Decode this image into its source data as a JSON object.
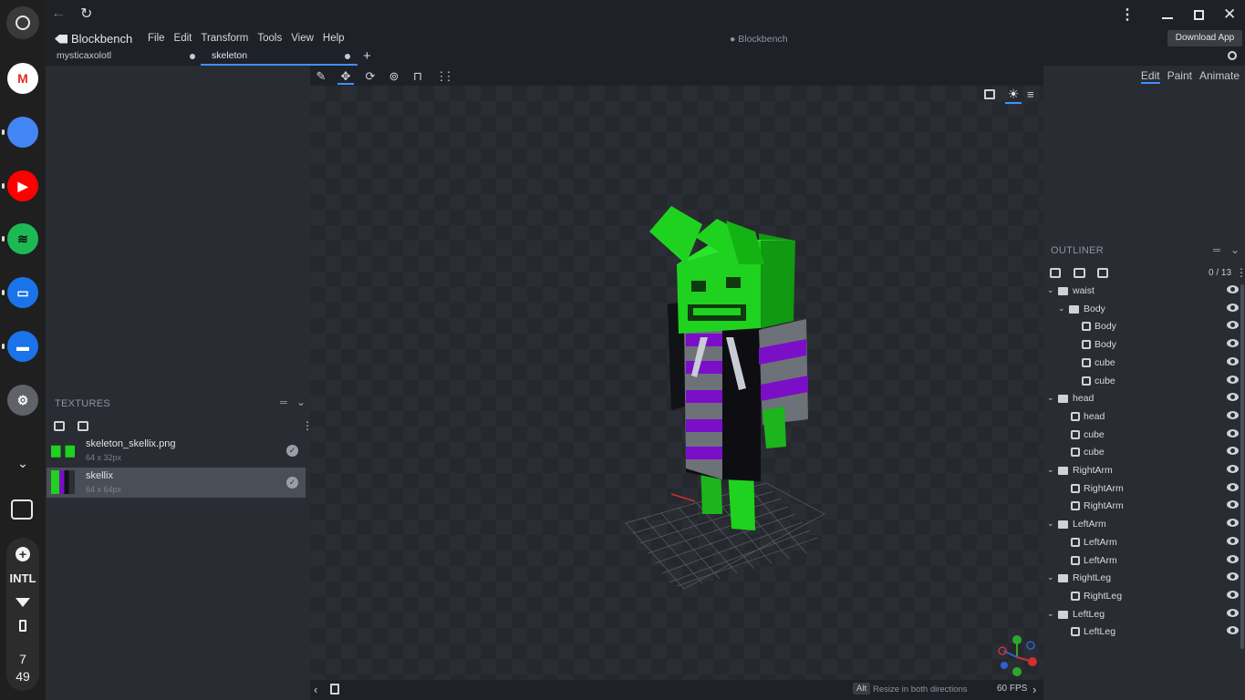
{
  "shelf": {
    "apps": [
      {
        "name": "gmail-app-icon",
        "glyph": "M",
        "color": "#ffffff",
        "fg": "#d93025"
      },
      {
        "name": "chrome-app-icon",
        "glyph": "",
        "color": "#4285f4",
        "fg": "#ffffff"
      },
      {
        "name": "youtube-app-icon",
        "glyph": "▶",
        "color": "#ff0000",
        "fg": "#ffffff"
      },
      {
        "name": "spotify-app-icon",
        "glyph": "≋",
        "color": "#1db954",
        "fg": "#111111"
      },
      {
        "name": "remote-desktop-app-icon",
        "glyph": "▭",
        "color": "#1a73e8",
        "fg": "#ffffff"
      },
      {
        "name": "files-app-icon",
        "glyph": "▬",
        "color": "#1a73e8",
        "fg": "#ffffff"
      },
      {
        "name": "settings-app-icon",
        "glyph": "⚙",
        "color": "#5f6368",
        "fg": "#ffffff"
      }
    ],
    "ime": "INTL",
    "clock_hour": "7",
    "clock_min": "49"
  },
  "app": {
    "title": "Blockbench",
    "center_title": "● Blockbench",
    "menu": [
      "File",
      "Edit",
      "Transform",
      "Tools",
      "View",
      "Help"
    ],
    "tooltip": "Download App"
  },
  "tabs": [
    {
      "label": "mysticaxolotl",
      "active": false
    },
    {
      "label": "skeleton",
      "active": true
    }
  ],
  "textures": {
    "header": "TEXTURES",
    "items": [
      {
        "name": "skeleton_skellix.png",
        "size": "64 x 32px",
        "selected": false
      },
      {
        "name": "skellix",
        "size": "64 x 64px",
        "selected": true
      }
    ]
  },
  "modes": [
    "Edit",
    "Paint",
    "Animate"
  ],
  "outliner": {
    "header": "OUTLINER",
    "count": "0 / 13",
    "nodes": [
      {
        "label": "waist",
        "kind": "group",
        "depth": 0
      },
      {
        "label": "Body",
        "kind": "group",
        "depth": 1
      },
      {
        "label": "Body",
        "kind": "cube",
        "depth": 2
      },
      {
        "label": "Body",
        "kind": "cube",
        "depth": 2
      },
      {
        "label": "cube",
        "kind": "cube",
        "depth": 2
      },
      {
        "label": "cube",
        "kind": "cube",
        "depth": 2
      },
      {
        "label": "head",
        "kind": "group",
        "depth": 0
      },
      {
        "label": "head",
        "kind": "cube",
        "depth": 1
      },
      {
        "label": "cube",
        "kind": "cube",
        "depth": 1
      },
      {
        "label": "cube",
        "kind": "cube",
        "depth": 1
      },
      {
        "label": "RightArm",
        "kind": "group",
        "depth": 0
      },
      {
        "label": "RightArm",
        "kind": "cube",
        "depth": 1
      },
      {
        "label": "RightArm",
        "kind": "cube",
        "depth": 1
      },
      {
        "label": "LeftArm",
        "kind": "group",
        "depth": 0
      },
      {
        "label": "LeftArm",
        "kind": "cube",
        "depth": 1
      },
      {
        "label": "LeftArm",
        "kind": "cube",
        "depth": 1
      },
      {
        "label": "RightLeg",
        "kind": "group",
        "depth": 0
      },
      {
        "label": "RightLeg",
        "kind": "cube",
        "depth": 1
      },
      {
        "label": "LeftLeg",
        "kind": "group",
        "depth": 0
      },
      {
        "label": "LeftLeg",
        "kind": "cube",
        "depth": 1
      }
    ]
  },
  "status": {
    "key": "Alt",
    "hint": "Resize in both directions",
    "fps": "60 FPS"
  },
  "colors": {
    "accent": "#3e90ff",
    "model_green": "#1fd21f",
    "model_purple": "#7a0fc7",
    "model_gray": "#6d7178"
  }
}
